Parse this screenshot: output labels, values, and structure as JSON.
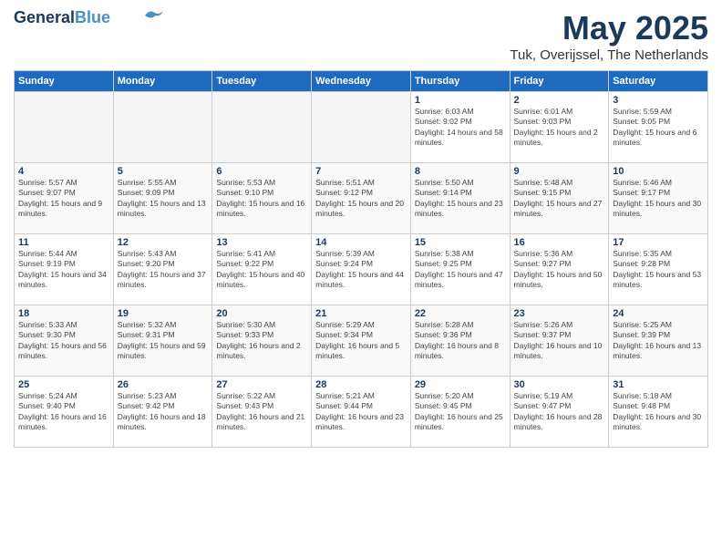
{
  "header": {
    "logo_line1": "General",
    "logo_line2": "Blue",
    "month": "May 2025",
    "location": "Tuk, Overijssel, The Netherlands"
  },
  "weekdays": [
    "Sunday",
    "Monday",
    "Tuesday",
    "Wednesday",
    "Thursday",
    "Friday",
    "Saturday"
  ],
  "weeks": [
    [
      {
        "day": "",
        "empty": true
      },
      {
        "day": "",
        "empty": true
      },
      {
        "day": "",
        "empty": true
      },
      {
        "day": "",
        "empty": true
      },
      {
        "day": "1",
        "sunrise": "6:03 AM",
        "sunset": "9:02 PM",
        "daylight": "14 hours and 58 minutes."
      },
      {
        "day": "2",
        "sunrise": "6:01 AM",
        "sunset": "9:03 PM",
        "daylight": "15 hours and 2 minutes."
      },
      {
        "day": "3",
        "sunrise": "5:59 AM",
        "sunset": "9:05 PM",
        "daylight": "15 hours and 6 minutes."
      }
    ],
    [
      {
        "day": "4",
        "sunrise": "5:57 AM",
        "sunset": "9:07 PM",
        "daylight": "15 hours and 9 minutes."
      },
      {
        "day": "5",
        "sunrise": "5:55 AM",
        "sunset": "9:09 PM",
        "daylight": "15 hours and 13 minutes."
      },
      {
        "day": "6",
        "sunrise": "5:53 AM",
        "sunset": "9:10 PM",
        "daylight": "15 hours and 16 minutes."
      },
      {
        "day": "7",
        "sunrise": "5:51 AM",
        "sunset": "9:12 PM",
        "daylight": "15 hours and 20 minutes."
      },
      {
        "day": "8",
        "sunrise": "5:50 AM",
        "sunset": "9:14 PM",
        "daylight": "15 hours and 23 minutes."
      },
      {
        "day": "9",
        "sunrise": "5:48 AM",
        "sunset": "9:15 PM",
        "daylight": "15 hours and 27 minutes."
      },
      {
        "day": "10",
        "sunrise": "5:46 AM",
        "sunset": "9:17 PM",
        "daylight": "15 hours and 30 minutes."
      }
    ],
    [
      {
        "day": "11",
        "sunrise": "5:44 AM",
        "sunset": "9:19 PM",
        "daylight": "15 hours and 34 minutes."
      },
      {
        "day": "12",
        "sunrise": "5:43 AM",
        "sunset": "9:20 PM",
        "daylight": "15 hours and 37 minutes."
      },
      {
        "day": "13",
        "sunrise": "5:41 AM",
        "sunset": "9:22 PM",
        "daylight": "15 hours and 40 minutes."
      },
      {
        "day": "14",
        "sunrise": "5:39 AM",
        "sunset": "9:24 PM",
        "daylight": "15 hours and 44 minutes."
      },
      {
        "day": "15",
        "sunrise": "5:38 AM",
        "sunset": "9:25 PM",
        "daylight": "15 hours and 47 minutes."
      },
      {
        "day": "16",
        "sunrise": "5:36 AM",
        "sunset": "9:27 PM",
        "daylight": "15 hours and 50 minutes."
      },
      {
        "day": "17",
        "sunrise": "5:35 AM",
        "sunset": "9:28 PM",
        "daylight": "15 hours and 53 minutes."
      }
    ],
    [
      {
        "day": "18",
        "sunrise": "5:33 AM",
        "sunset": "9:30 PM",
        "daylight": "15 hours and 56 minutes."
      },
      {
        "day": "19",
        "sunrise": "5:32 AM",
        "sunset": "9:31 PM",
        "daylight": "15 hours and 59 minutes."
      },
      {
        "day": "20",
        "sunrise": "5:30 AM",
        "sunset": "9:33 PM",
        "daylight": "16 hours and 2 minutes."
      },
      {
        "day": "21",
        "sunrise": "5:29 AM",
        "sunset": "9:34 PM",
        "daylight": "16 hours and 5 minutes."
      },
      {
        "day": "22",
        "sunrise": "5:28 AM",
        "sunset": "9:36 PM",
        "daylight": "16 hours and 8 minutes."
      },
      {
        "day": "23",
        "sunrise": "5:26 AM",
        "sunset": "9:37 PM",
        "daylight": "16 hours and 10 minutes."
      },
      {
        "day": "24",
        "sunrise": "5:25 AM",
        "sunset": "9:39 PM",
        "daylight": "16 hours and 13 minutes."
      }
    ],
    [
      {
        "day": "25",
        "sunrise": "5:24 AM",
        "sunset": "9:40 PM",
        "daylight": "16 hours and 16 minutes."
      },
      {
        "day": "26",
        "sunrise": "5:23 AM",
        "sunset": "9:42 PM",
        "daylight": "16 hours and 18 minutes."
      },
      {
        "day": "27",
        "sunrise": "5:22 AM",
        "sunset": "9:43 PM",
        "daylight": "16 hours and 21 minutes."
      },
      {
        "day": "28",
        "sunrise": "5:21 AM",
        "sunset": "9:44 PM",
        "daylight": "16 hours and 23 minutes."
      },
      {
        "day": "29",
        "sunrise": "5:20 AM",
        "sunset": "9:45 PM",
        "daylight": "16 hours and 25 minutes."
      },
      {
        "day": "30",
        "sunrise": "5:19 AM",
        "sunset": "9:47 PM",
        "daylight": "16 hours and 28 minutes."
      },
      {
        "day": "31",
        "sunrise": "5:18 AM",
        "sunset": "9:48 PM",
        "daylight": "16 hours and 30 minutes."
      }
    ]
  ]
}
